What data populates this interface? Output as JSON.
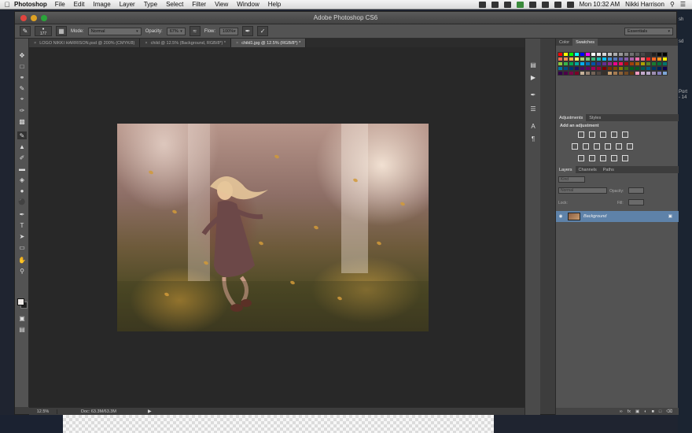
{
  "menubar": {
    "app": "Photoshop",
    "items": [
      "File",
      "Edit",
      "Image",
      "Layer",
      "Type",
      "Select",
      "Filter",
      "View",
      "Window",
      "Help"
    ],
    "clock": "Mon 10:32 AM",
    "user": "Nikki Harrison"
  },
  "window": {
    "title": "Adobe Photoshop CS6"
  },
  "options": {
    "brush_size": "177",
    "mode_label": "Mode:",
    "mode_value": "Normal",
    "opacity_label": "Opacity:",
    "opacity_value": "67%",
    "flow_label": "Flow:",
    "flow_value": "100%",
    "workspace": "Essentials"
  },
  "tabs": [
    {
      "label": "LOGO NIKKI HARRISON.psd @ 200% (CMYK/8)",
      "active": false
    },
    {
      "label": "child @ 12.5% (Background, RGB/8*) *",
      "active": false
    },
    {
      "label": "child1.jpg @ 12.5% (RGB/8*) *",
      "active": true
    }
  ],
  "status": {
    "zoom": "12.5%",
    "doc": "Doc: 63.3M/63.3M"
  },
  "swatch_panel": {
    "tabs": [
      "Color",
      "Swatches"
    ],
    "colors": [
      "#ff0000",
      "#ffff00",
      "#00ff00",
      "#00ffff",
      "#0000ff",
      "#ff00ff",
      "#ffffff",
      "#ebebeb",
      "#d6d6d6",
      "#c2c2c2",
      "#adadad",
      "#999999",
      "#858585",
      "#707070",
      "#5c5c5c",
      "#474747",
      "#333333",
      "#1f1f1f",
      "#0a0a0a",
      "#000000",
      "#f26c4f",
      "#f68e55",
      "#fbad4a",
      "#fff467",
      "#acd372",
      "#7cc576",
      "#3bb878",
      "#1abbb4",
      "#00bff3",
      "#438cca",
      "#5574b9",
      "#605ca8",
      "#855fa8",
      "#a763a8",
      "#f06ea9",
      "#f26d7d",
      "#ed1c24",
      "#f26522",
      "#f7941d",
      "#fff200",
      "#8dc73f",
      "#39b54a",
      "#00a651",
      "#00a99d",
      "#00aeef",
      "#0072bc",
      "#0054a6",
      "#2e3192",
      "#662d91",
      "#92278f",
      "#ec008c",
      "#ed145b",
      "#9e0b0f",
      "#a0410d",
      "#a36209",
      "#aba000",
      "#598527",
      "#197b30",
      "#007236",
      "#00746b",
      "#0076a3",
      "#004b80",
      "#003471",
      "#1b1464",
      "#440e62",
      "#630460",
      "#9e005d",
      "#9e0039",
      "#790000",
      "#7b2e00",
      "#7d4900",
      "#827b00",
      "#406618",
      "#005e20",
      "#005826",
      "#005952",
      "#005b7f",
      "#003663",
      "#002157",
      "#0d004c",
      "#32004b",
      "#4b0049",
      "#7b0046",
      "#7a0026",
      "#c7b299",
      "#998675",
      "#736357",
      "#534741",
      "#37302a",
      "#c69c6d",
      "#a67c52",
      "#8c6239",
      "#754c24",
      "#603913",
      "#f49ac1",
      "#c4a9cc",
      "#b8a9c9",
      "#9e8eb1",
      "#8781bd",
      "#7ea7d8"
    ]
  },
  "adjust_panel": {
    "tabs": [
      "Adjustments",
      "Styles"
    ],
    "label": "Add an adjustment"
  },
  "layers_panel": {
    "tabs": [
      "Layers",
      "Channels",
      "Paths"
    ],
    "kind": "Kind",
    "blend": "Normal",
    "opacity_label": "Opacity:",
    "lock_label": "Lock:",
    "fill_label": "Fill:",
    "layer_name": "Background"
  },
  "desktop_right": [
    "sh",
    "sd",
    "Port",
    "- 14"
  ]
}
